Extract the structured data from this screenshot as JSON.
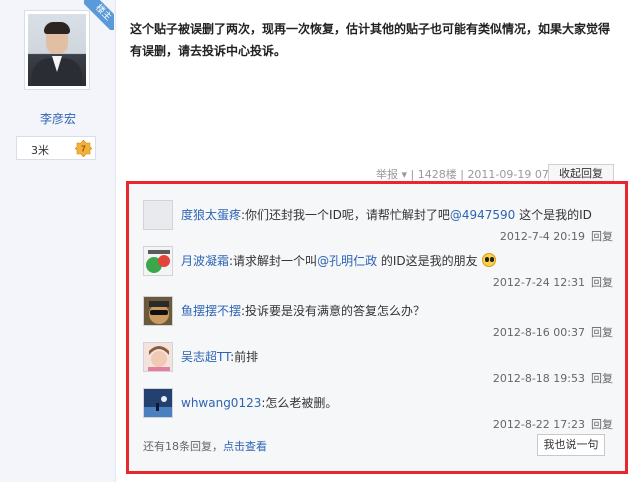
{
  "author": {
    "badge": "楼主",
    "name": "李彦宏",
    "level_text": "3米",
    "level_number": "7"
  },
  "post": {
    "text": "这个贴子被误删了两次，现再一次恢复，估计其他的贴子也可能有类似情况，如果大家觉得有误删，请去投诉中心投诉。",
    "report": "举报",
    "floor": "1428楼",
    "date": "2011-09-19 07:18",
    "reply_button": "收起回复"
  },
  "comments": [
    {
      "user": "度狼太蛋疼",
      "pre": ":你们还封我一个ID呢，请帮忙解封了吧",
      "mention": "@4947590",
      "post": " 这个是我的ID",
      "time": "2012-7-4 20:19",
      "reply": "回复",
      "avatar_color": "#e2e4e8"
    },
    {
      "user": "月波凝霜",
      "pre": ":请求解封一个叫",
      "mention": "@孔明仁政",
      "post": " 的ID这是我的朋友",
      "time": "2012-7-24 12:31",
      "reply": "回复",
      "avatar_color": "#7bc36a"
    },
    {
      "user": "鱼摆摆不摆",
      "pre": ":投诉要是没有满意的答复怎么办？",
      "mention": "",
      "post": "",
      "time": "2012-8-16 00:37",
      "reply": "回复",
      "avatar_color": "#6b5a3a"
    },
    {
      "user": "吴志超TT",
      "pre": ":前排",
      "mention": "",
      "post": "",
      "time": "2012-8-18 19:53",
      "reply": "回复",
      "avatar_color": "#e8c9c0"
    },
    {
      "user": "whwang0123",
      "pre": ":怎么老被删。",
      "mention": "",
      "post": "",
      "time": "2012-8-22 17:23",
      "reply": "回复",
      "avatar_color": "#3b5a8c"
    }
  ],
  "footer": {
    "more_prefix": "还有18条回复，",
    "more_link": "点击查看",
    "say_button": "我也说一句"
  },
  "colors": {
    "highlight_border": "#e8262f",
    "link": "#2d64b3"
  }
}
